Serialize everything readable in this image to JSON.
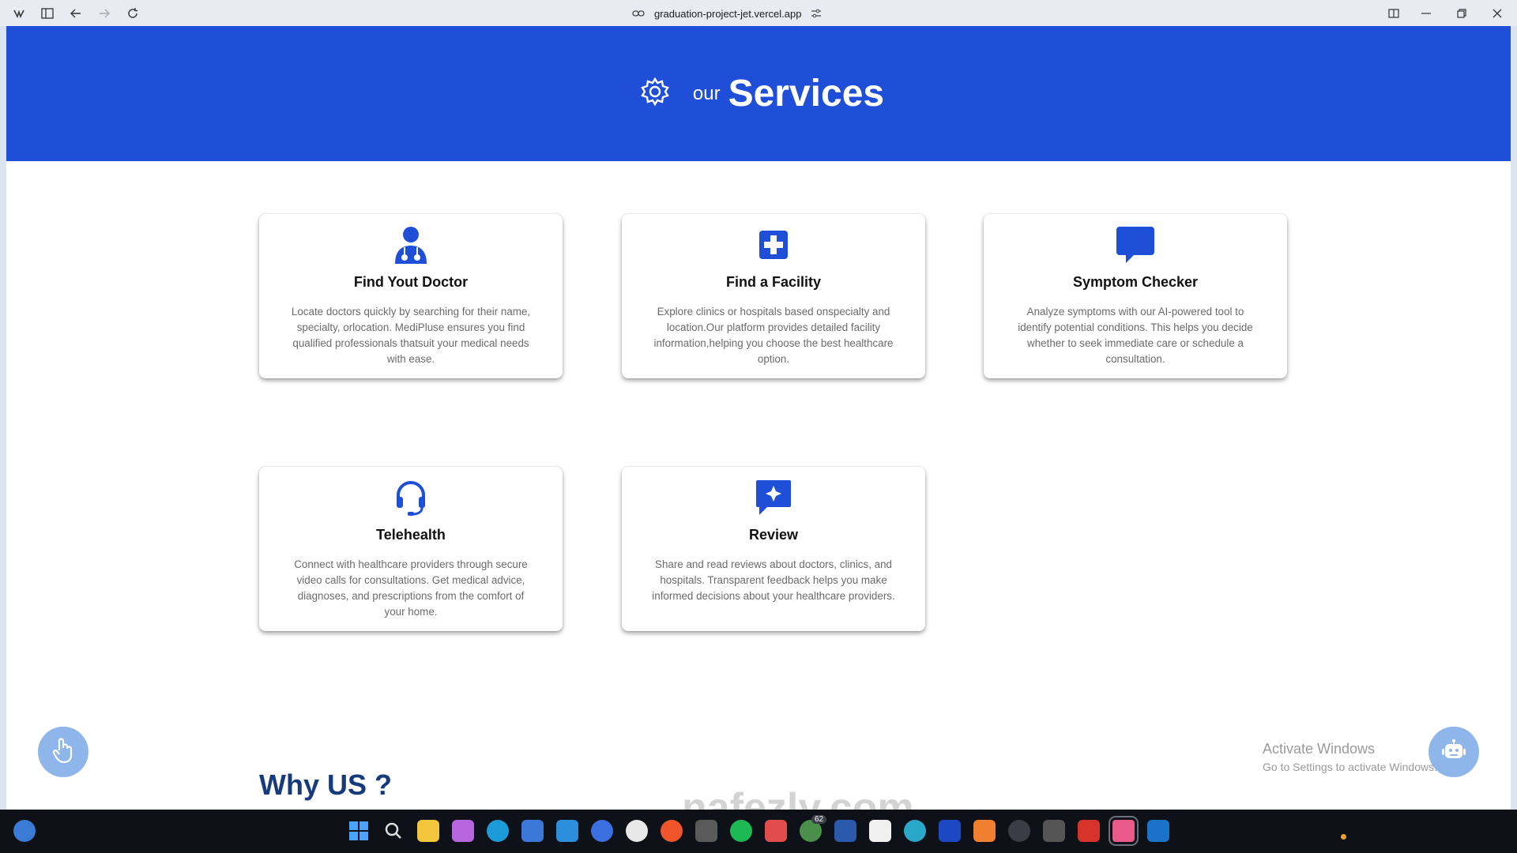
{
  "browser": {
    "url": "graduation-project-jet.vercel.app"
  },
  "hero": {
    "prefix": "our",
    "title": "Services"
  },
  "services": [
    {
      "icon": "doctor-icon",
      "title": "Find Yout Doctor",
      "description": "Locate doctors quickly by searching for their name, specialty, orlocation. MediPluse ensures you find qualified professionals thatsuit your medical needs with ease."
    },
    {
      "icon": "hospital-plus-icon",
      "title": "Find a Facility",
      "description": "Explore clinics or hospitals based onspecialty and location.Our platform provides detailed facility information,helping you choose the best healthcare option."
    },
    {
      "icon": "chat-bubble-icon",
      "title": "Symptom Checker",
      "description": "Analyze symptoms with our AI-powered tool to identify potential conditions. This helps you decide whether to seek immediate care or schedule a consultation."
    },
    {
      "icon": "headset-icon",
      "title": "Telehealth",
      "description": "Connect with healthcare providers through secure video calls for consultations. Get medical advice, diagnoses, and prescriptions from the comfort of your home."
    },
    {
      "icon": "review-sparkle-icon",
      "title": "Review",
      "description": "Share and read reviews about doctors, clinics, and hospitals. Transparent feedback helps you make informed decisions about your healthcare providers."
    }
  ],
  "why_us": {
    "heading": "Why US ?"
  },
  "overlay": {
    "activate_title": "Activate Windows",
    "activate_sub": "Go to Settings to activate Windows.",
    "watermark": "nafezly.com"
  },
  "taskbar": {
    "badge": "62"
  },
  "colors": {
    "primary": "#1f4ed8",
    "heading": "#163a7c",
    "fab": "#8eb6ea"
  }
}
